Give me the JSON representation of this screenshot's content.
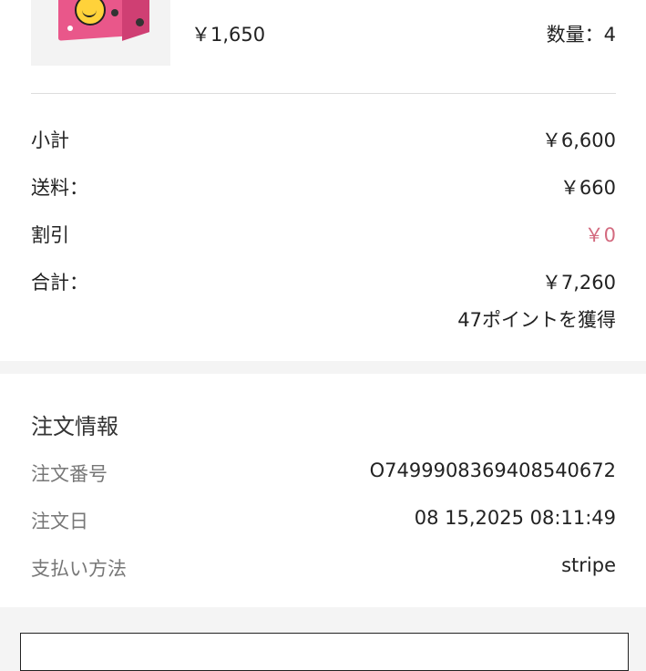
{
  "product": {
    "price": "￥1,650",
    "quantity": "数量：4"
  },
  "summary": {
    "subtotal_label": "小計",
    "subtotal_value": "￥6,600",
    "shipping_label": "送料：",
    "shipping_value": "￥660",
    "discount_label": "割引",
    "discount_value": "￥0",
    "total_label": "合計：",
    "total_value": "￥7,260",
    "points": "47ポイントを獲得"
  },
  "order_info": {
    "title": "注文情報",
    "order_no_label": "注文番号",
    "order_no_value": "O7499908369408540672",
    "order_date_label": "注文日",
    "order_date_value": "08 15,2025 08:11:49",
    "payment_label": "支払い方法",
    "payment_value": "stripe"
  },
  "colors": {
    "discount": "#d36a7f",
    "product_box": "#e9578a"
  },
  "icons": [
    "smiley-character"
  ]
}
